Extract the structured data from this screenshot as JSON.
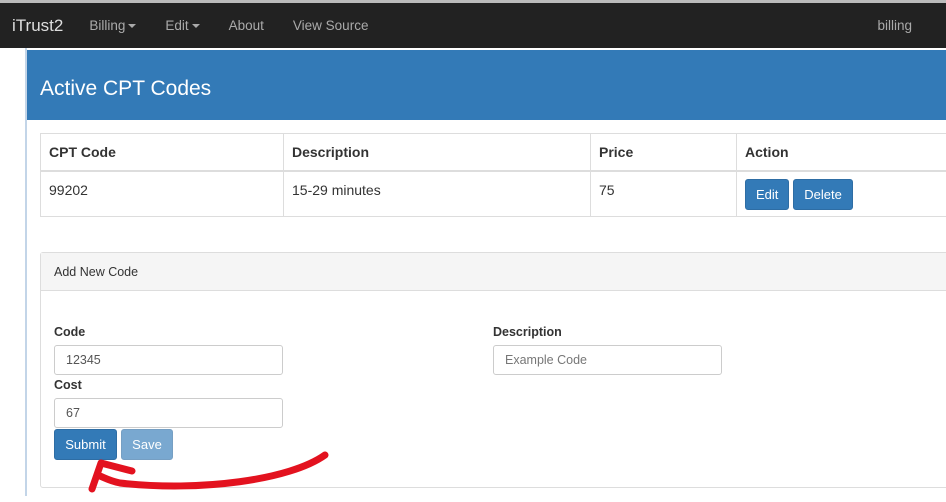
{
  "nav": {
    "brand": "iTrust2",
    "items": [
      "Billing",
      "Edit",
      "About",
      "View Source"
    ],
    "user": "billing"
  },
  "header": {
    "title": "Active CPT Codes"
  },
  "table": {
    "columns": [
      "CPT Code",
      "Description",
      "Price",
      "Action"
    ],
    "rows": [
      {
        "code": "99202",
        "description": "15-29 minutes",
        "price": "75"
      }
    ],
    "edit_label": "Edit",
    "delete_label": "Delete"
  },
  "form": {
    "title": "Add New Code",
    "code_label": "Code",
    "code_value": "12345",
    "description_label": "Description",
    "description_placeholder": "Example Code",
    "cost_label": "Cost",
    "cost_value": "67",
    "submit_label": "Submit",
    "save_label": "Save"
  },
  "colors": {
    "primary": "#337ab7",
    "annotation": "#e3121f"
  }
}
